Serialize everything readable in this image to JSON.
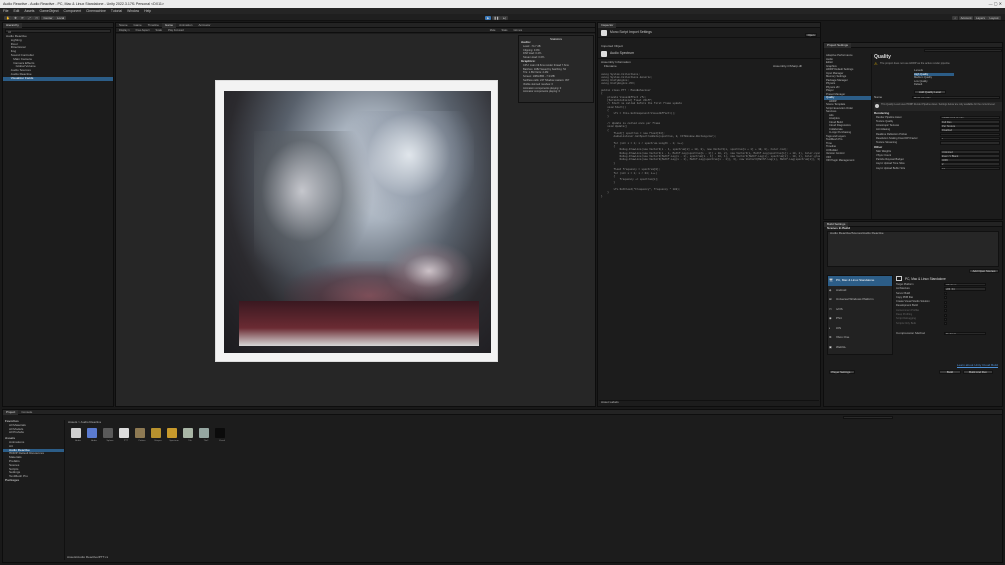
{
  "window": {
    "title": "Audio Reactive - Audio Reactive - PC, Mac & Linux Standalone - Unity 2022.3.17f1 Personal <DX11>"
  },
  "menu": [
    "File",
    "Edit",
    "Assets",
    "GameObject",
    "Component",
    "Cinemachine",
    "Tutorial",
    "Window",
    "Help"
  ],
  "toolbar": {
    "left": [
      "Center",
      "Local",
      "Pivot",
      "Grid"
    ],
    "right": [
      "Account",
      "Layers",
      "Layout"
    ]
  },
  "hierarchy": {
    "tab": "Hierarchy",
    "search_placeholder": "All",
    "items": [
      "Audio Reactive",
      "Lighting",
      "Floor",
      "Directional",
      "Fog",
      "Sound Controller",
      "Main Camera",
      "Camera Effects",
      "Global Volume",
      "Audio Sources",
      "Audio Reactive",
      "Visualizer Fields"
    ]
  },
  "scene": {
    "tabs": [
      "Scene",
      "Game",
      "Timeline",
      "Game",
      "Animation",
      "Animator"
    ],
    "subtabs": [
      "Display 1",
      "Free Aspect",
      "Scale",
      "Play Focused",
      "Mute",
      "Stats",
      "Gizmos"
    ],
    "stats": {
      "title": "Statistics",
      "audio_label": "Audio:",
      "audio": [
        "Level: -74.7 dB",
        "Clipping: 0.0%",
        "DSP load: 0.4%",
        "Stream load: 0.0%"
      ],
      "graphics_label": "Graphics:",
      "graphics": [
        "CPU: main 19.6ms  render thread 7.6ms",
        "Batches: 1082  Saved by batching: 54",
        "Tris: 1.6M  Verts: 2.4M",
        "Screen: 1084x586 - 7.3 MB",
        "SetPass calls: 247  Shadow casters: 457",
        "Visible skinned meshes: 0",
        "Animation components playing: 0",
        "Animator components playing: 0"
      ]
    }
  },
  "inspector": {
    "tab": "Inspector",
    "header": "Mono Script Import Settings",
    "object_label": "Open",
    "script_name": "Audio Spectrum",
    "assembly_label": "Assembly Information",
    "filename": "Filename",
    "filename_value": "Assembly-CSharp.dll",
    "imported_object": "Imported Object",
    "code": "using System.Collections;\nusing System.Collections.Generic;\nusing UnityEngine;\nusing UnityEngine.VFX;\n\npublic class PTT : MonoBehaviour\n{\n    private VisualEffect vfx;\n    [SerializeField] float zDiff;\n    // Start is called before the first frame update\n    void Start()\n    {\n        vfx = this.GetComponent<VisualEffect>();\n    }\n\n    // Update is called once per frame\n    void Update()\n    {\n        float[] spectrum = new float[64];\n        AudioListener.GetSpectrumData(spectrum, 0, FFTWindow.Rectangular);\n\n        for (int i = 1; i < spectrum.Length - 1; i++)\n        {\n            Debug.DrawLine(new Vector3(i - 1, spectrum[i] + 10, 0), new Vector3(i, spectrum[i + 1] + 10, 0), Color.red);\n            Debug.DrawLine(new Vector3(i - 1, Mathf.Log(spectrum[i - 1]) + 10, 2), new Vector3(i, Mathf.Log(spectrum[i]) + 10, 2), Color.cyan);\n            Debug.DrawLine(new Vector3(Mathf.Log(i - 1), spectrum[i - 1] - 10, 1), new Vector3(Mathf.Log(i), spectrum[i] - 10, 1), Color.green);\n            Debug.DrawLine(new Vector3(Mathf.Log(i - 1), Mathf.Log(spectrum[i - 1]), 3), new Vector3(Mathf.Log(i), Mathf.Log(spectrum[i]), 3), Color.blue);\n        }\n\n        float frequency = spectrum[0];\n        for (int i = 1; i < 64; i++)\n        {\n            frequency += spectrum[i];\n        }\n\n        vfx.SetFloat(\"Frequency\", frequency * 100);\n    }\n}",
    "asset_labels": "Asset Labels"
  },
  "project_settings": {
    "title": "Project Settings",
    "search_placeholder": "",
    "categories": [
      "Adaptive Performance",
      "Audio",
      "Editor",
      "Graphics",
      "HDRP Default Settings",
      "Input Manager",
      "Memory Settings",
      "Package Manager",
      "Physics",
      "Physics 2D",
      "Player",
      "Preset Manager",
      "Quality",
      "HDRP",
      "Scene Template",
      "Script Execution Order",
      "Services",
      "Ads",
      "Analytics",
      "Cloud Build",
      "Cloud Diagnostics",
      "Collaborate",
      "In-App Purchasing",
      "Tags and Layers",
      "TextMesh Pro",
      "Time",
      "Timeline",
      "UI Builder",
      "Version Control",
      "VFX",
      "XR Plugin Management"
    ],
    "selected": "Quality",
    "heading": "Quality",
    "warning": "The project does not use HDRP as the active render pipeline.",
    "levels_label": "Levels",
    "levels": [
      "High Quality",
      "Medium Quality",
      "Low Quality",
      "Default"
    ],
    "add_level": "Add Quality Level",
    "name_label": "Name",
    "name_value": "High Quality",
    "info": "This Quality Level uses HDRP Render Pipeline Asset. Settings below are only available for the current level.",
    "rendering_label": "Rendering",
    "rendering": [
      {
        "k": "Render Pipeline Asset",
        "v": "HDRP High Quality"
      },
      {
        "k": "Texture Quality",
        "v": "Full Res"
      },
      {
        "k": "Anisotropic Textures",
        "v": "Per Texture"
      },
      {
        "k": "Anti Aliasing",
        "v": "Disabled"
      },
      {
        "k": "Realtime Reflection Probes",
        "v": ""
      },
      {
        "k": "Resolution Scaling Fixed DPI Factor",
        "v": "1"
      },
      {
        "k": "Texture Streaming",
        "v": ""
      }
    ],
    "other_label": "Other",
    "other": [
      {
        "k": "Skin Weights",
        "v": "Unlimited"
      },
      {
        "k": "VSync Count",
        "v": "Every V Blank"
      },
      {
        "k": "Particle Raycast Budget",
        "v": "4096"
      },
      {
        "k": "Async Upload Time Slice",
        "v": "2"
      },
      {
        "k": "Async Upload Buffer Size",
        "v": "16"
      }
    ]
  },
  "build_settings": {
    "title": "Build Settings",
    "scenes_label": "Scenes In Build",
    "scene": "Audio Reactive/Scenes/Audio Reactive",
    "add_open": "Add Open Scenes",
    "platform_label": "Platform",
    "platforms": [
      "PC, Mac & Linux Standalone",
      "Android",
      "Universal Windows Platform",
      "tvOS",
      "PS4",
      "iOS",
      "Xbox One",
      "WebGL"
    ],
    "selected_platform": "PC, Mac & Linux Standalone",
    "target_heading": "PC, Mac & Linux Standalone",
    "options": [
      {
        "k": "Target Platform",
        "v": "Windows"
      },
      {
        "k": "Architecture",
        "v": "x86_64"
      },
      {
        "k": "Server Build",
        "v": ""
      },
      {
        "k": "Copy PDB files",
        "v": ""
      },
      {
        "k": "Create Visual Studio Solution",
        "v": ""
      },
      {
        "k": "Development Build",
        "v": ""
      },
      {
        "k": "Autoconnect Profiler",
        "v": ""
      },
      {
        "k": "Deep Profiling",
        "v": ""
      },
      {
        "k": "Script Debugging",
        "v": ""
      },
      {
        "k": "Scripts Only Build",
        "v": ""
      }
    ],
    "compression_label": "Compression Method",
    "compression_value": "Default",
    "cloud_link": "Learn about Unity Cloud Build",
    "player_settings": "Player Settings...",
    "build": "Build",
    "build_and_run": "Build And Run"
  },
  "project": {
    "tabs": [
      "Project",
      "Console"
    ],
    "favorites_label": "Favorites",
    "favorites": [
      "All Materials",
      "All Models",
      "All Prefabs"
    ],
    "assets_label": "Assets",
    "folders": [
      "Animations",
      "Art",
      "Audio Reactive",
      "HDRP Default Resources",
      "Materials",
      "Prefabs",
      "Scenes",
      "Scripts",
      "Settings",
      "TextMesh Pro"
    ],
    "packages_label": "Packages",
    "breadcrumb": "Assets > Audio Reactive",
    "assets": [
      "Audio",
      "Audio",
      "Sphere",
      "PTT",
      "Pattern",
      "Shapes",
      "Spectrum",
      "Tile",
      "Tile2",
      "Visual"
    ],
    "path": "Assets/Audio Reactive/PTT.cs"
  }
}
